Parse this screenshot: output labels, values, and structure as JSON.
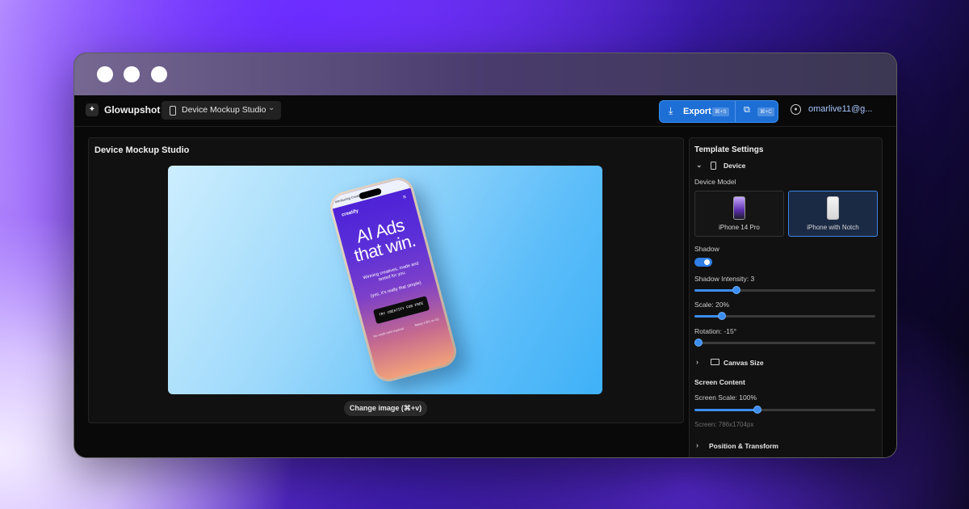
{
  "app": {
    "name": "Glowupshot",
    "studio_select": "Device Mockup Studio",
    "export_label": "Export",
    "export_shortcut": "⌘+S",
    "copy_shortcut": "⌘+C",
    "user_email": "omarlive11@g..."
  },
  "canvas": {
    "title": "Device Mockup Studio",
    "change_image_label": "Change image (⌘+v)"
  },
  "phone_screen": {
    "status": "Introducing Creatify 2.0",
    "brand": "creatify",
    "headline_line1": "AI Ads",
    "headline_line2": "that win.",
    "subtitle": "Winning creatives, made and tested for you.",
    "note": "(yes, it's really that simple)",
    "cta": "TRY CREATIFY FOR FREE",
    "foot_left": "No credit card required",
    "foot_right": "Rated 4.8/5 on G2"
  },
  "settings": {
    "title": "Template Settings",
    "device_section": "Device",
    "device_model_label": "Device Model",
    "models": [
      {
        "name": "iPhone 14 Pro",
        "selected": false
      },
      {
        "name": "iPhone with Notch",
        "selected": true
      }
    ],
    "shadow_label": "Shadow",
    "shadow_on": true,
    "shadow_intensity_label": "Shadow Intensity: 3",
    "shadow_intensity": 3,
    "scale_label": "Scale: 20%",
    "scale": 20,
    "rotation_label": "Rotation: -15°",
    "rotation": -15,
    "canvas_size_section": "Canvas Size",
    "screen_content_label": "Screen Content",
    "screen_scale_label": "Screen Scale: 100%",
    "screen_scale": 100,
    "screen_size": "Screen: 786x1704px",
    "position_section": "Position & Transform"
  },
  "slider_levels": {
    "shadow_intensity": 0.23,
    "scale": 0.15,
    "rotation": 0.0,
    "screen_scale": 0.35
  },
  "colors": {
    "accent": "#3b8ef0",
    "background": "#090909",
    "panel": "#111111"
  }
}
